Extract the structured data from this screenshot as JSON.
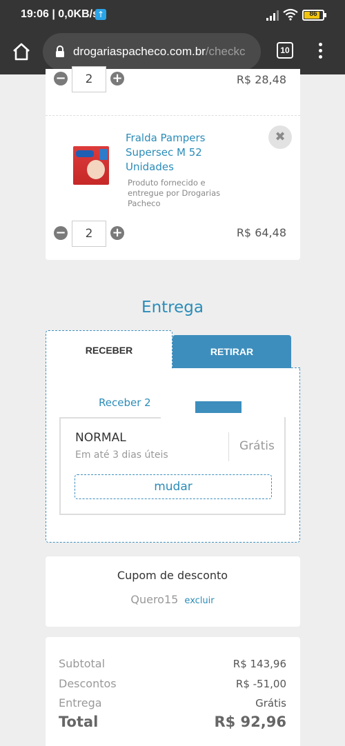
{
  "status_bar": {
    "time": "19:06",
    "network_speed": "| 0,0KB/s",
    "battery": "86"
  },
  "browser": {
    "url_domain": "drogariaspacheco.com.br",
    "url_path": "/checkc",
    "tab_count": "10"
  },
  "cart": {
    "item1": {
      "quantity": "2",
      "price": "R$ 28,48"
    },
    "item2": {
      "name": "Fralda Pampers Supersec M 52 Unidades",
      "seller_note": "Produto fornecido e entregue por Drogarias Pacheco",
      "quantity": "2",
      "price": "R$ 64,48",
      "remove_symbol": "✖"
    }
  },
  "delivery": {
    "title": "Entrega",
    "tabs": [
      "RECEBER",
      "RETIRAR"
    ],
    "sub_tab": "Receber 2",
    "option": {
      "name": "NORMAL",
      "eta": "Em até 3 dias úteis",
      "price": "Grátis",
      "change_label": "mudar"
    }
  },
  "coupon": {
    "title": "Cupom de desconto",
    "code": "Quero15",
    "remove_label": "excluir"
  },
  "summary": {
    "subtotal_label": "Subtotal",
    "subtotal_value": "R$ 143,96",
    "discount_label": "Descontos",
    "discount_value": "R$ -51,00",
    "delivery_label": "Entrega",
    "delivery_value": "Grátis",
    "total_label": "Total",
    "total_value": "R$ 92,96"
  },
  "colors": {
    "accent": "#3d8ebd",
    "link": "#2b8cb8",
    "topbar": "#353535"
  }
}
